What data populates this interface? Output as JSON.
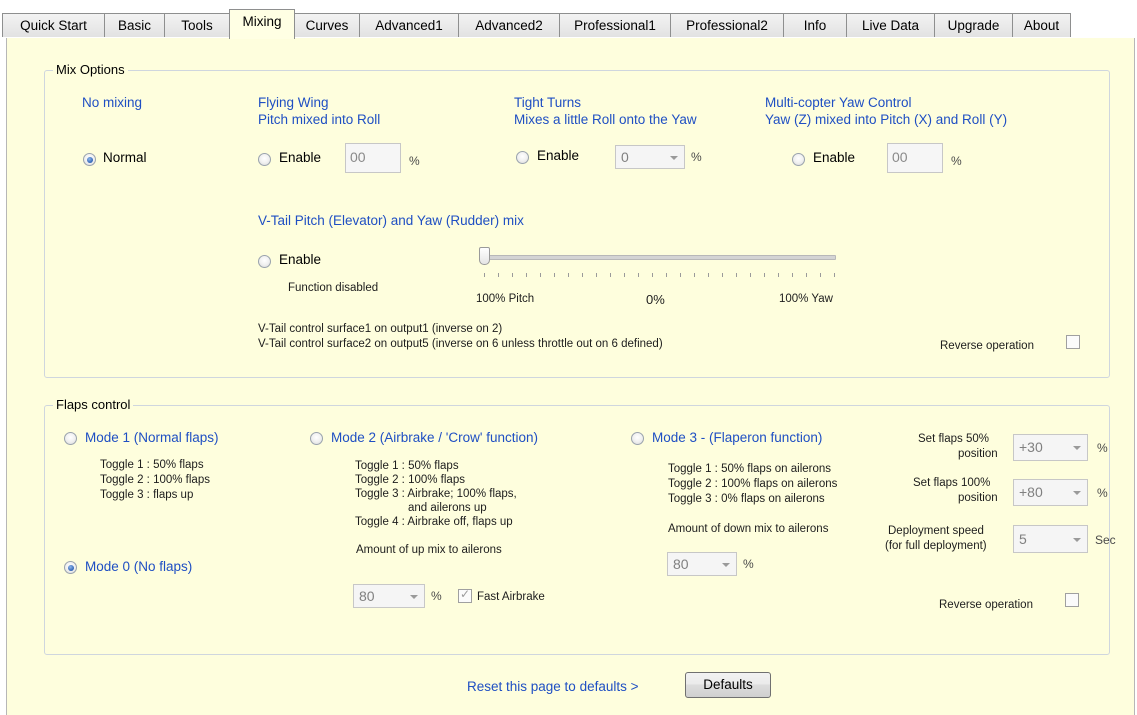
{
  "tabs": [
    {
      "label": "Quick Start",
      "active": false
    },
    {
      "label": "Basic",
      "active": false
    },
    {
      "label": "Tools",
      "active": false
    },
    {
      "label": "Mixing",
      "active": true
    },
    {
      "label": "Curves",
      "active": false
    },
    {
      "label": "Advanced1",
      "active": false
    },
    {
      "label": "Advanced2",
      "active": false
    },
    {
      "label": "Professional1",
      "active": false
    },
    {
      "label": "Professional2",
      "active": false
    },
    {
      "label": "Info",
      "active": false
    },
    {
      "label": "Live Data",
      "active": false
    },
    {
      "label": "Upgrade",
      "active": false
    },
    {
      "label": "About",
      "active": false
    }
  ],
  "mix_options": {
    "title": "Mix Options",
    "no_mixing": {
      "header": "No mixing",
      "radio_label": "Normal",
      "checked": true
    },
    "flying_wing": {
      "header1": "Flying Wing",
      "header2": "Pitch mixed into Roll",
      "radio_label": "Enable",
      "value": "00",
      "unit": "%",
      "checked": false
    },
    "tight_turns": {
      "header1": "Tight Turns",
      "header2": "Mixes a little Roll onto the Yaw",
      "radio_label": "Enable",
      "value": "0",
      "unit": "%",
      "checked": false
    },
    "multicopter": {
      "header1": "Multi-copter Yaw Control",
      "header2": "Yaw (Z) mixed into Pitch (X) and Roll (Y)",
      "radio_label": "Enable",
      "value": "00",
      "unit": "%",
      "checked": false
    },
    "vtail": {
      "header": "V-Tail Pitch (Elevator) and Yaw (Rudder) mix",
      "radio_label": "Enable",
      "status": "Function disabled",
      "slider_left": "100% Pitch",
      "slider_mid": "0%",
      "slider_right": "100% Yaw",
      "slider_value_fraction": 0,
      "note1": "V-Tail control surface1 on output1 (inverse on 2)",
      "note2": "V-Tail control surface2 on output5 (inverse on 6 unless throttle out on 6 defined)",
      "reverse_label": "Reverse operation",
      "checked": false
    }
  },
  "flaps": {
    "title": "Flaps control",
    "mode1": {
      "label": "Mode 1 (Normal flaps)",
      "lines": [
        "Toggle 1 : 50% flaps",
        "Toggle 2 : 100% flaps",
        "Toggle 3 : flaps up"
      ],
      "checked": false
    },
    "mode0": {
      "label": "Mode 0 (No flaps)",
      "checked": true
    },
    "mode2": {
      "label": "Mode 2 (Airbrake / 'Crow' function)",
      "lines": [
        "Toggle 1 : 50% flaps",
        "Toggle 2 : 100% flaps",
        "Toggle 3 : Airbrake; 100% flaps,",
        "and ailerons up",
        "Toggle 4 : Airbrake off, flaps up"
      ],
      "amount_label": "Amount of up mix to ailerons",
      "amount_value": "80",
      "unit": "%",
      "fast_airbrake": "Fast Airbrake",
      "fast_checked": true,
      "checked": false
    },
    "mode3": {
      "label": "Mode 3 - (Flaperon function)",
      "lines": [
        "Toggle 1 : 50% flaps on ailerons",
        "Toggle 2 : 100% flaps on ailerons",
        "Toggle 3 : 0% flaps on ailerons"
      ],
      "amount_label": "Amount of down mix to ailerons",
      "amount_value": "80",
      "unit": "%",
      "checked": false
    },
    "set50": {
      "label1": "Set flaps 50%",
      "label2": "position",
      "value": "+30",
      "unit": "%"
    },
    "set100": {
      "label1": "Set flaps 100%",
      "label2": "position",
      "value": "+80",
      "unit": "%"
    },
    "deploy": {
      "label1": "Deployment speed",
      "label2": "(for full deployment)",
      "value": "5",
      "unit": "Sec"
    },
    "reverse_label": "Reverse operation"
  },
  "footer": {
    "reset_text": "Reset this page to defaults >",
    "defaults_button": "Defaults"
  }
}
